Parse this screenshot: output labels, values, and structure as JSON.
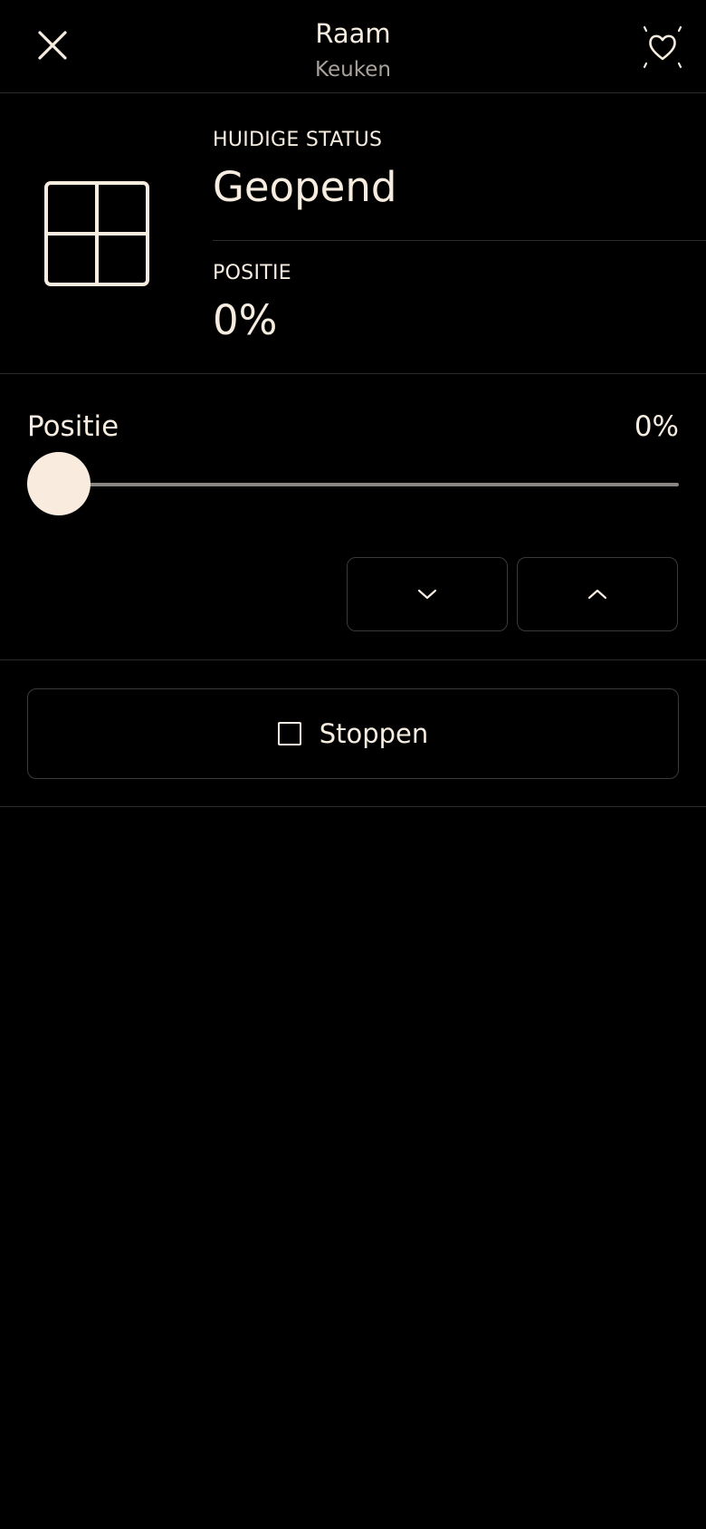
{
  "header": {
    "title": "Raam",
    "subtitle": "Keuken",
    "close_icon": "close-icon",
    "favorite_icon": "heart-outline-icon"
  },
  "status": {
    "device_icon": "window-icon",
    "current_status_label": "HUIDIGE STATUS",
    "current_status_value": "Geopend",
    "position_label": "POSITIE",
    "position_value": "0%"
  },
  "position_control": {
    "label": "Positie",
    "value_text": "0%",
    "slider_value_percent": 0,
    "down_icon": "chevron-down-icon",
    "up_icon": "chevron-up-icon"
  },
  "stop": {
    "icon": "stop-square-icon",
    "label": "Stoppen"
  },
  "colors": {
    "background": "#000000",
    "text": "#f6ecdf",
    "muted_text": "#a8a29b",
    "divider": "#2b2b2b",
    "slider_thumb": "#f9ecdf",
    "slider_track": "#8a8682"
  }
}
